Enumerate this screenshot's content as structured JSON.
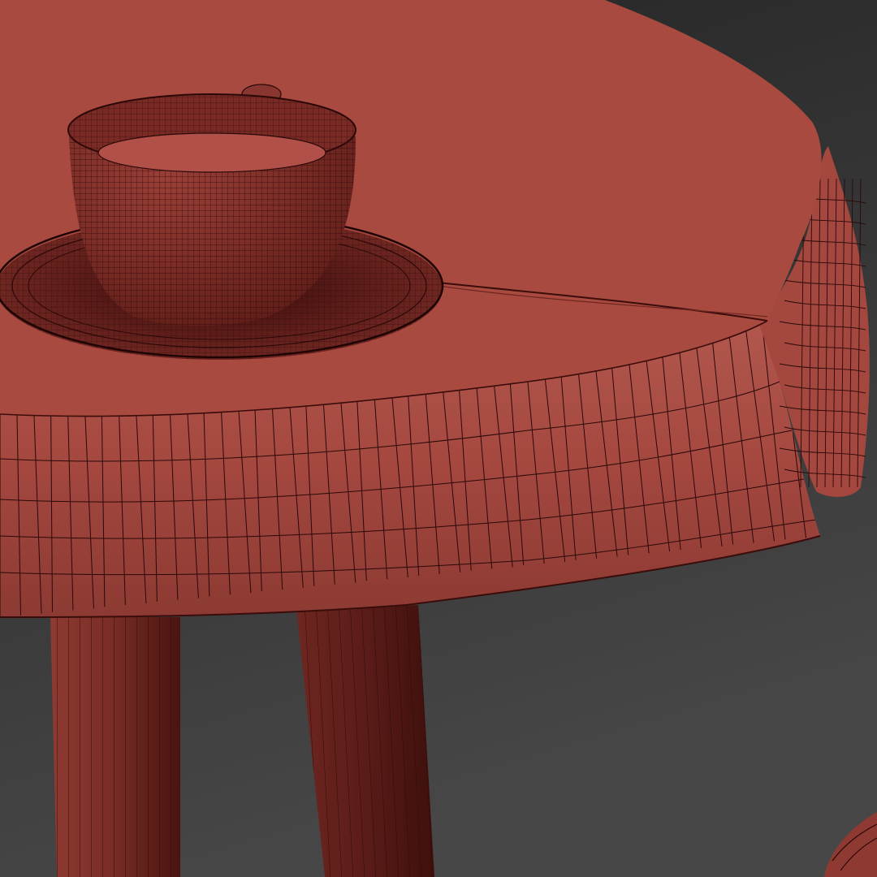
{
  "scene": {
    "background_top": "#2a2a2a",
    "background_bottom": "#474747",
    "mesh_color": "#a84a40",
    "mesh_shadow": "#5a1a16",
    "mesh_highlight": "#b9605a",
    "wire_color": "#2a0808",
    "objects": [
      "tablecloth",
      "cup",
      "saucer",
      "table-leg",
      "table-leg",
      "stool-fragment"
    ]
  }
}
